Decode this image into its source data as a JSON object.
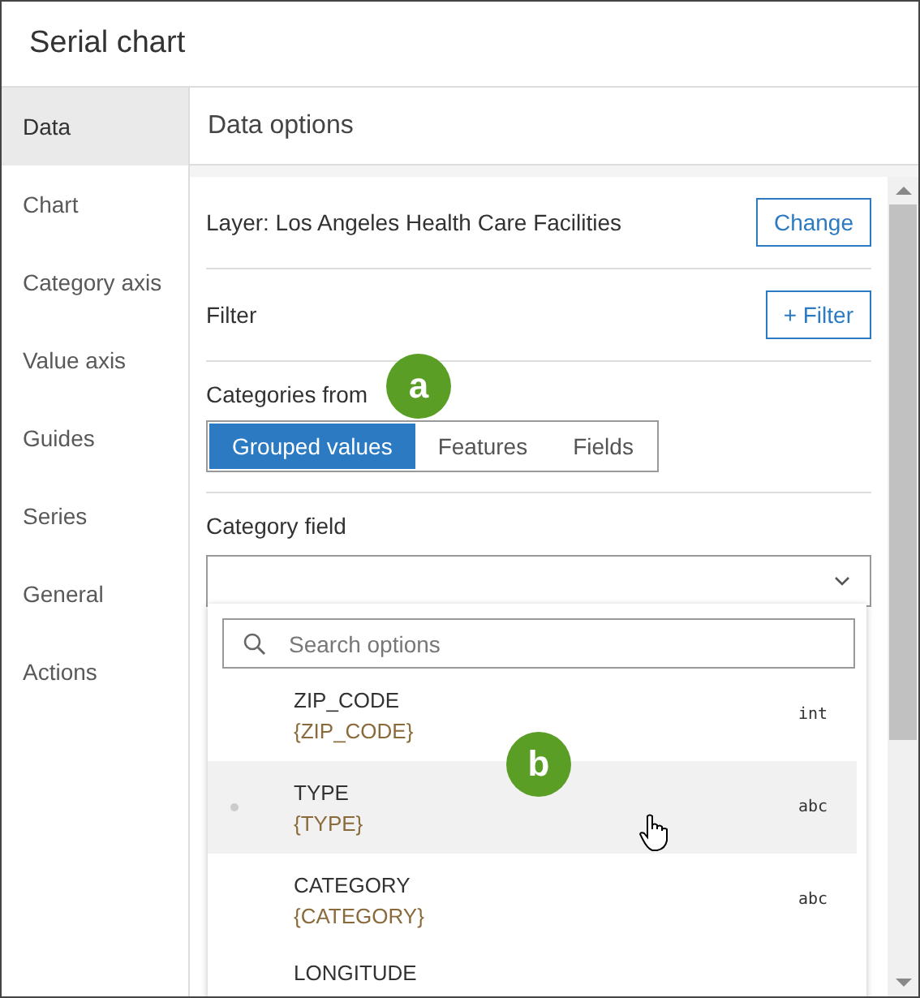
{
  "window": {
    "title": "Serial chart"
  },
  "sidebar": {
    "items": [
      {
        "label": "Data",
        "selected": true
      },
      {
        "label": "Chart",
        "selected": false
      },
      {
        "label": "Category axis",
        "selected": false
      },
      {
        "label": "Value axis",
        "selected": false
      },
      {
        "label": "Guides",
        "selected": false
      },
      {
        "label": "Series",
        "selected": false
      },
      {
        "label": "General",
        "selected": false
      },
      {
        "label": "Actions",
        "selected": false
      }
    ]
  },
  "panel": {
    "title": "Data options",
    "layer": {
      "label": "Layer: Los Angeles Health Care Facilities",
      "button": "Change"
    },
    "filter": {
      "label": "Filter",
      "button": "+ Filter"
    },
    "categories_from": {
      "label": "Categories from",
      "options": [
        {
          "label": "Grouped values",
          "selected": true
        },
        {
          "label": "Features",
          "selected": false
        },
        {
          "label": "Fields",
          "selected": false
        }
      ]
    },
    "category_field": {
      "label": "Category field"
    }
  },
  "dropdown": {
    "search": {
      "placeholder": "Search options"
    },
    "options": [
      {
        "name": "ZIP_CODE",
        "alias": "{ZIP_CODE}",
        "type": "int",
        "highlighted": false
      },
      {
        "name": "TYPE",
        "alias": "{TYPE}",
        "type": "abc",
        "highlighted": true
      },
      {
        "name": "CATEGORY",
        "alias": "{CATEGORY}",
        "type": "abc",
        "highlighted": false
      },
      {
        "name": "LONGITUDE",
        "highlighted": false
      }
    ]
  },
  "callouts": [
    {
      "label": "a"
    },
    {
      "label": "b"
    }
  ]
}
